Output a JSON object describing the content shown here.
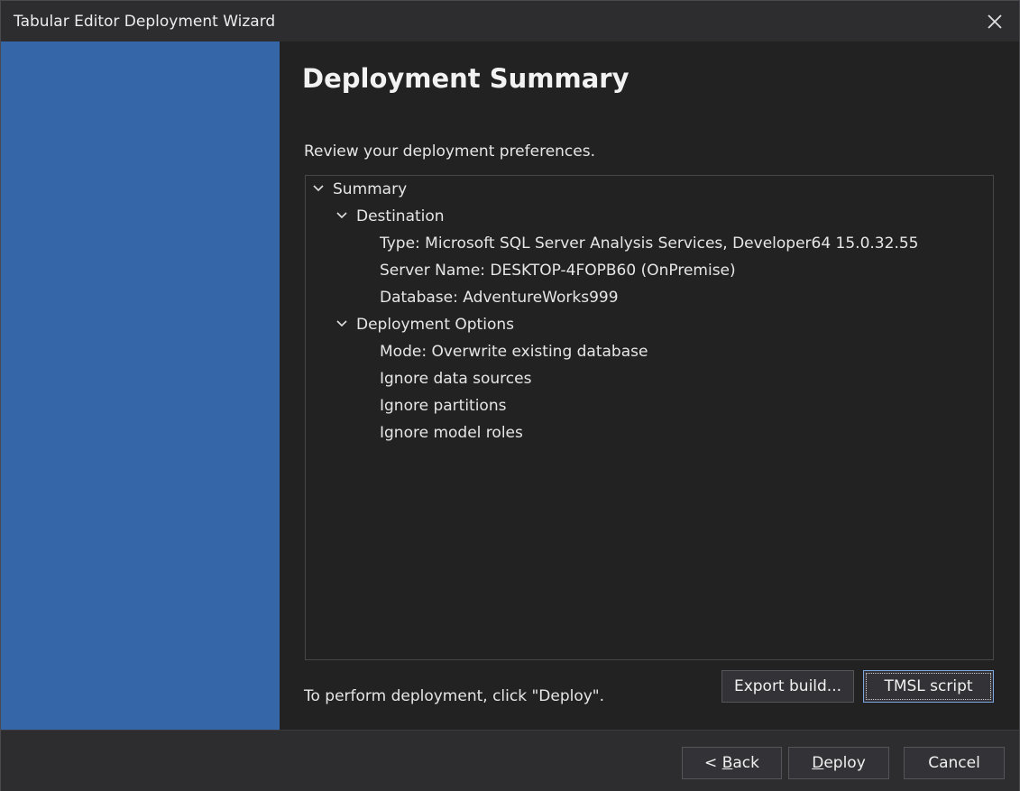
{
  "window": {
    "title": "Tabular Editor Deployment Wizard"
  },
  "page": {
    "heading": "Deployment Summary",
    "subtitle": "Review your deployment preferences.",
    "footer_note": "To perform deployment, click \"Deploy\"."
  },
  "tree": {
    "root": "Summary",
    "destination": {
      "label": "Destination",
      "type": "Type: Microsoft SQL Server Analysis Services, Developer64 15.0.32.55",
      "server": "Server Name: DESKTOP-4FOPB60 (OnPremise)",
      "database": "Database: AdventureWorks999"
    },
    "options": {
      "label": "Deployment Options",
      "mode": "Mode: Overwrite existing database",
      "ignore_sources": "Ignore data sources",
      "ignore_partitions": "Ignore partitions",
      "ignore_roles": "Ignore model roles"
    }
  },
  "buttons": {
    "export_build": "Export build...",
    "tmsl_script": "TMSL script",
    "back_prefix": "< ",
    "back_key": "B",
    "back_rest": "ack",
    "deploy_key": "D",
    "deploy_rest": "eploy",
    "cancel": "Cancel"
  },
  "icons": {
    "close": "close-icon",
    "expand": "chevron-down-icon"
  },
  "colors": {
    "sidebar": "#3466a8",
    "content_bg": "#222222",
    "chrome_bg": "#2d2d30",
    "focus_border": "#7aa7e0"
  }
}
